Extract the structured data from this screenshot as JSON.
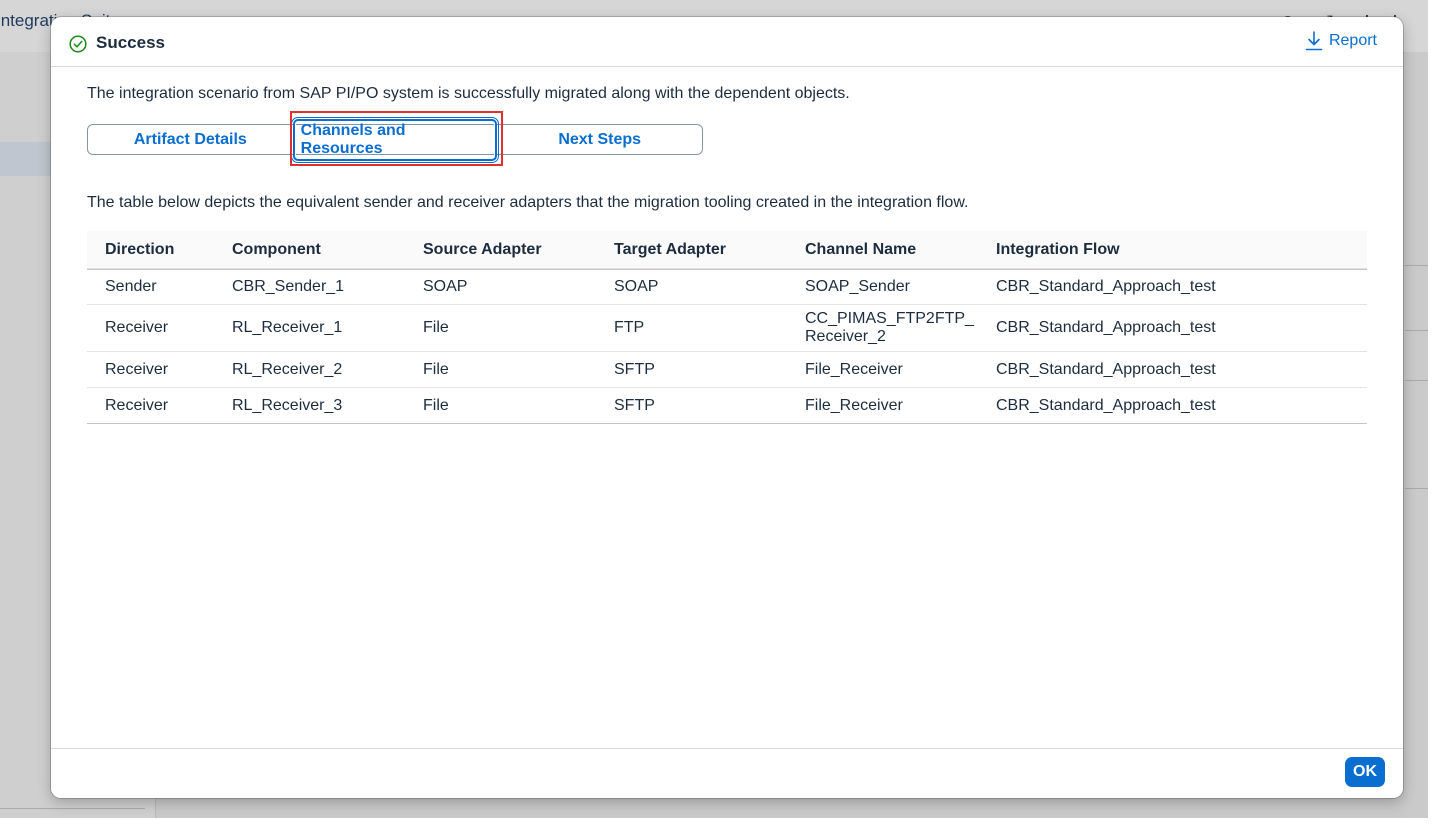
{
  "background_app": {
    "title": "Integration Suite",
    "header_icons": "⟲ ⤢ ⋮⋮"
  },
  "dialog": {
    "title": "Success",
    "report_label": "Report",
    "intro_text": "The integration scenario from SAP PI/PO system is successfully migrated along with the dependent objects.",
    "tabs": [
      {
        "label": "Artifact Details"
      },
      {
        "label": "Channels and Resources",
        "selected": true
      },
      {
        "label": "Next Steps"
      }
    ],
    "description": "The table below depicts the equivalent sender and receiver adapters that the migration tooling created in the integration flow.",
    "table": {
      "columns": [
        "Direction",
        "Component",
        "Source Adapter",
        "Target Adapter",
        "Channel Name",
        "Integration Flow"
      ],
      "rows": [
        [
          "Sender",
          "CBR_Sender_1",
          "SOAP",
          "SOAP",
          "SOAP_Sender",
          "CBR_Standard_Approach_test"
        ],
        [
          "Receiver",
          "RL_Receiver_1",
          "File",
          "FTP",
          "CC_PIMAS_FTP2FTP_Receiver_2",
          "CBR_Standard_Approach_test"
        ],
        [
          "Receiver",
          "RL_Receiver_2",
          "File",
          "SFTP",
          "File_Receiver",
          "CBR_Standard_Approach_test"
        ],
        [
          "Receiver",
          "RL_Receiver_3",
          "File",
          "SFTP",
          "File_Receiver",
          "CBR_Standard_Approach_test"
        ]
      ]
    },
    "ok_label": "OK"
  },
  "colors": {
    "accent": "#0a6ed1",
    "success": "#188918",
    "highlight": "#e0312f"
  },
  "icons": {
    "status": "success-check-icon",
    "report": "download-icon"
  }
}
